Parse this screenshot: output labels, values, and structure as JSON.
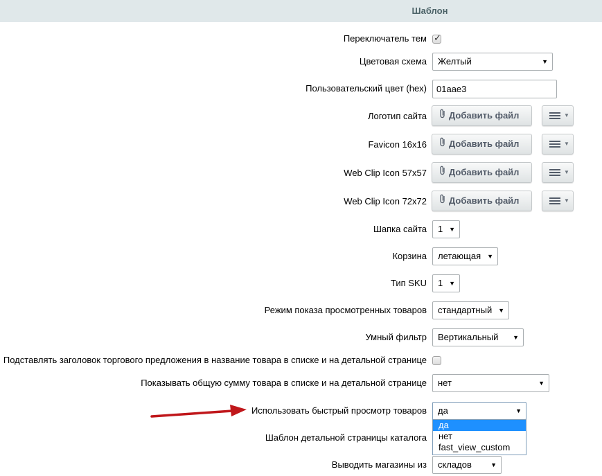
{
  "section_title": "Шаблон",
  "fields": {
    "theme_switcher": {
      "label": "Переключатель тем",
      "checked": true
    },
    "color_scheme": {
      "label": "Цветовая схема",
      "value": "Желтый"
    },
    "custom_color": {
      "label": "Пользовательский цвет (hex)",
      "value": "01aae3"
    },
    "site_logo": {
      "label": "Логотип сайта",
      "button": "Добавить файл"
    },
    "favicon": {
      "label": "Favicon 16x16",
      "button": "Добавить файл"
    },
    "webclip_57": {
      "label": "Web Clip Icon 57x57",
      "button": "Добавить файл"
    },
    "webclip_72": {
      "label": "Web Clip Icon 72x72",
      "button": "Добавить файл"
    },
    "site_header": {
      "label": "Шапка сайта",
      "value": "1"
    },
    "basket": {
      "label": "Корзина",
      "value": "летающая"
    },
    "sku_type": {
      "label": "Тип SKU",
      "value": "1"
    },
    "viewed_products_mode": {
      "label": "Режим показа просмотренных товаров",
      "value": "стандартный"
    },
    "smart_filter": {
      "label": "Умный фильтр",
      "value": "Вертикальный"
    },
    "offer_title_in_name": {
      "label": "Подставлять заголовок торгового предложения в название товара в списке и на детальной странице",
      "checked": false
    },
    "show_total_sum": {
      "label": "Показывать общую сумму товара в списке и на детальной странице",
      "value": "нет"
    },
    "quick_view": {
      "label": "Использовать быстрый просмотр товаров",
      "value": "да",
      "options": [
        "да",
        "нет",
        "fast_view_custom"
      ],
      "highlighted_option": "да"
    },
    "catalog_detail_template": {
      "label": "Шаблон детальной страницы каталога"
    },
    "stores_source": {
      "label": "Выводить магазины из",
      "value": "складов"
    }
  },
  "colors": {
    "header_bg": "#e0e8ea",
    "header_text": "#4b6267",
    "annotation_arrow": "#c0171b",
    "dropdown_highlight": "#1e90ff"
  }
}
